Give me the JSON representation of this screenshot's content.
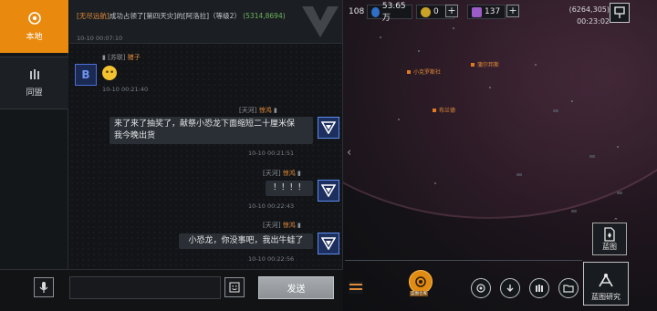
{
  "tabs": {
    "local": "本地",
    "alliance": "同盟"
  },
  "system_message": {
    "tag": "[无尽远航]",
    "text": "成功占领了[第四天灾]的[阿洛拉]（等级2）",
    "coord": "(5314,8694)",
    "time": "10-10 00:07:10"
  },
  "messages": [
    {
      "id": "m1",
      "side": "left",
      "alliance": "[苏联]",
      "name": "猪子",
      "avatar_letter": "B",
      "text": "",
      "emoji": true,
      "time": "10-10 00:21:40"
    },
    {
      "id": "m2",
      "side": "right",
      "alliance": "[天河]",
      "name": "惊鸿",
      "text_line1": "来了来了抽奖了，献祭小恐龙下面缩短二十厘米保",
      "text_line2": "我今晚出货",
      "time": "10-10 00:21:51"
    },
    {
      "id": "m3",
      "side": "right",
      "alliance": "[天河]",
      "name": "惊鸿",
      "text": "！！！！",
      "time": "10-10 00:22:43"
    },
    {
      "id": "m4",
      "side": "right",
      "alliance": "[天河]",
      "name": "惊鸿",
      "text": "小恐龙，你没事吧，我出牛蛙了",
      "time": "10-10 00:22:56"
    }
  ],
  "input": {
    "value": "",
    "send_label": "发送"
  },
  "resources": {
    "fuel": "108",
    "credits": "53.65万",
    "gold": "0",
    "crystals": "137"
  },
  "coords": {
    "position": "(6264,305)",
    "clock": "00:23:02"
  },
  "map_labels": {
    "poi1": "小克罗斯社",
    "poi2": "蒲尔邦斯",
    "poi3": "布兰德"
  },
  "bottom": {
    "blueprint_label": "蓝图",
    "research_label": "蓝图研究",
    "emblem_label": "蓝图仓库"
  },
  "colors": {
    "accent": "#e98a0f",
    "alliance_blue": "#4c6fd6",
    "coord_green": "#6fb25c"
  }
}
